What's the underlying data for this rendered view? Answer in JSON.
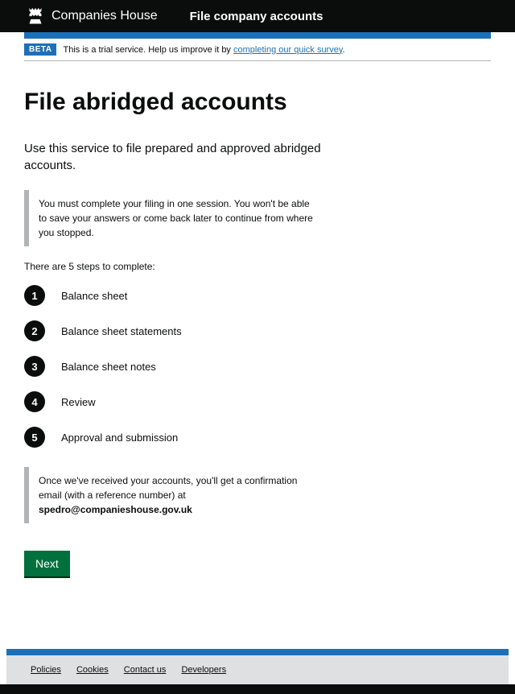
{
  "header": {
    "org_name": "Companies House",
    "service_name": "File company accounts"
  },
  "phase_banner": {
    "tag": "BETA",
    "text": "This is a trial service. Help us improve it by ",
    "link_text": "completing our quick survey",
    "suffix": "."
  },
  "main": {
    "heading": "File abridged accounts",
    "lead": "Use this service to file prepared and approved abridged accounts.",
    "inset_warning": "You must complete your filing in one session. You won't be able to save your answers or come back later to continue from where you stopped.",
    "steps_intro": "There are 5 steps to complete:",
    "steps": [
      {
        "num": "1",
        "label": "Balance sheet"
      },
      {
        "num": "2",
        "label": "Balance sheet statements"
      },
      {
        "num": "3",
        "label": "Balance sheet notes"
      },
      {
        "num": "4",
        "label": "Review"
      },
      {
        "num": "5",
        "label": "Approval and submission"
      }
    ],
    "confirmation_text": "Once we've received your accounts, you'll get a confirmation email (with a reference number) at ",
    "confirmation_email": "spedro@companieshouse.gov.uk",
    "next_button": "Next"
  },
  "footer": {
    "links": [
      {
        "label": "Policies"
      },
      {
        "label": "Cookies"
      },
      {
        "label": "Contact us"
      },
      {
        "label": "Developers"
      }
    ]
  }
}
